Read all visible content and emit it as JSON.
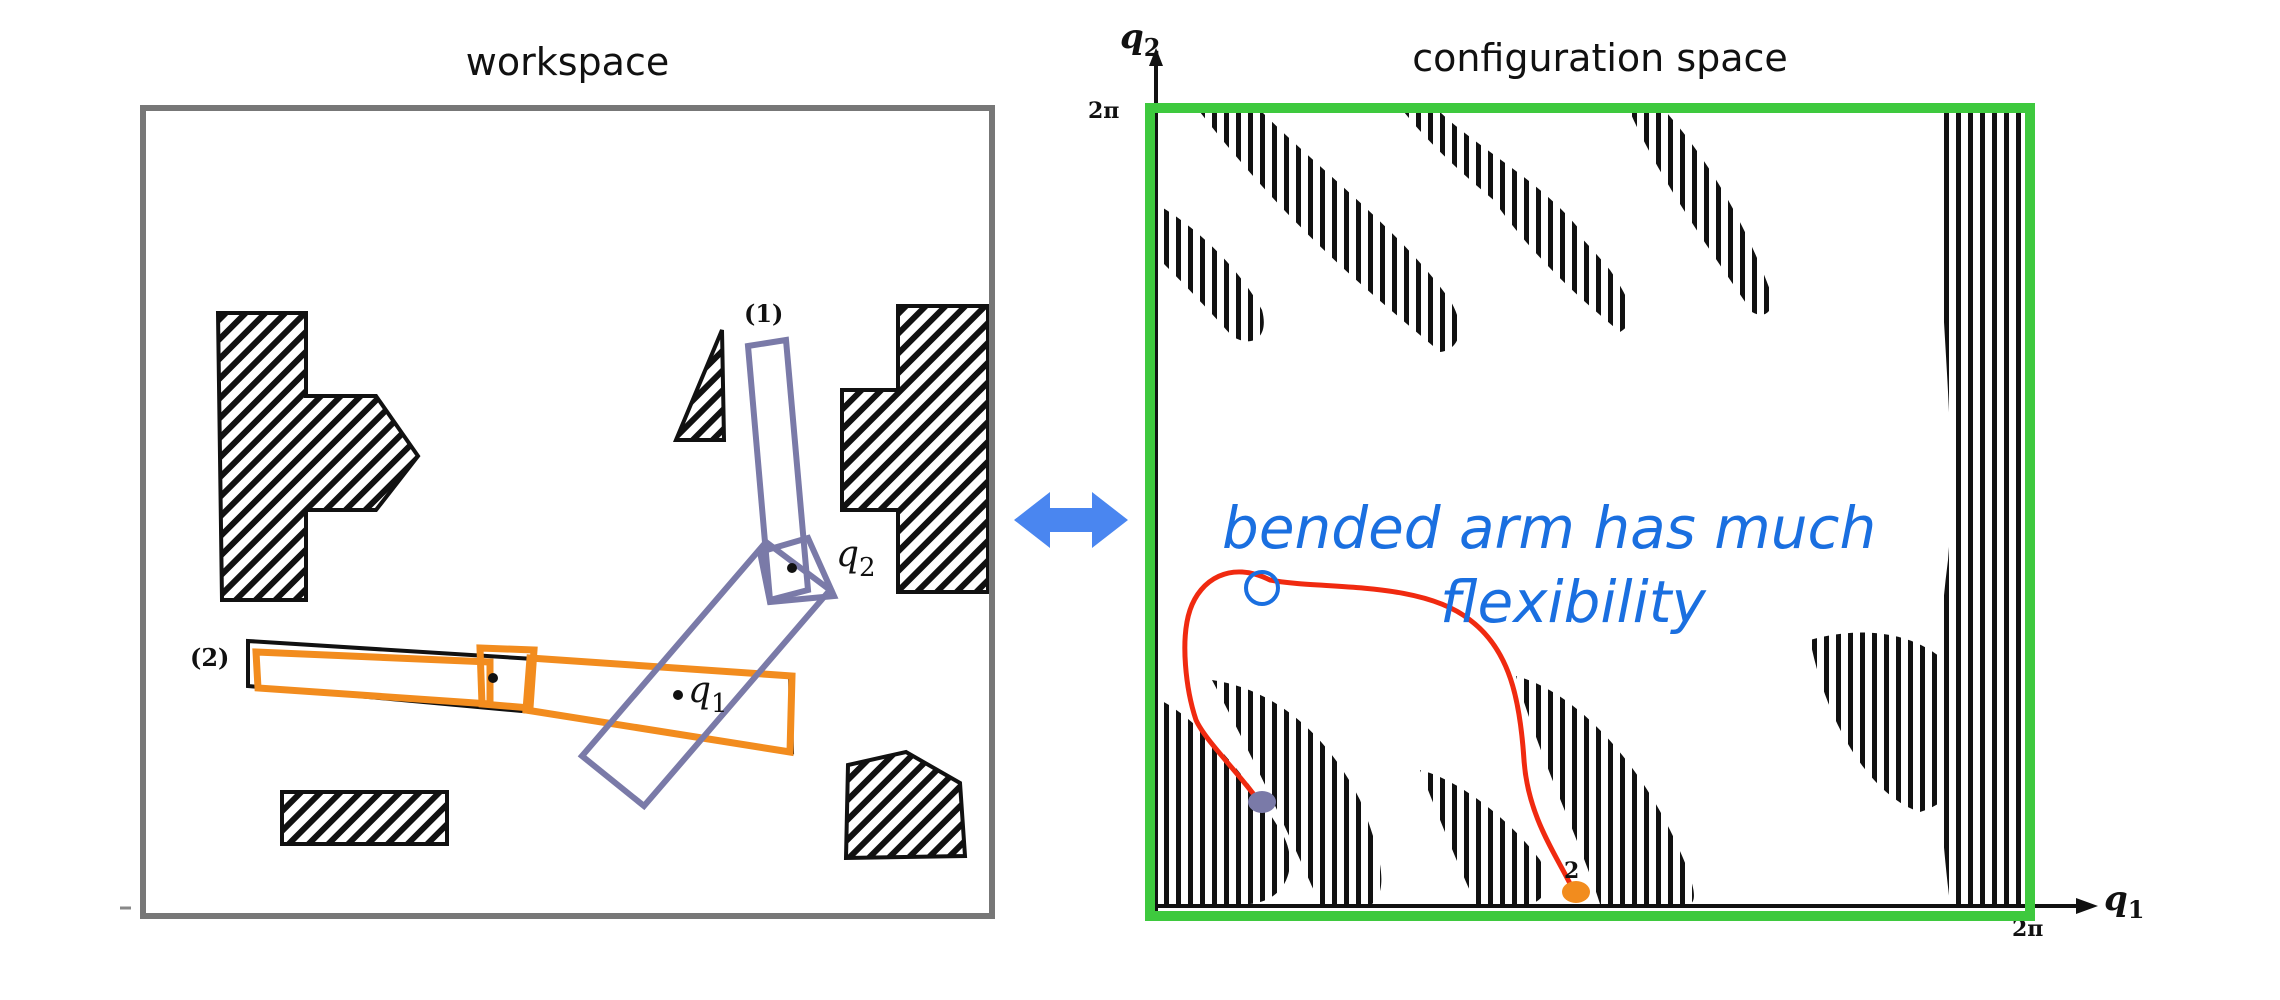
{
  "workspace": {
    "title": "workspace",
    "config_labels": {
      "one": "(1)",
      "two": "(2)"
    },
    "joint_labels": {
      "q1": "q",
      "q1_sub": "1",
      "q2": "q",
      "q2_sub": "2"
    }
  },
  "cspace": {
    "title": "configuration space",
    "axis_labels": {
      "q2": "q",
      "q2_sub": "2",
      "q1": "q",
      "q1_sub": "1",
      "two_pi_top": "2π",
      "two_pi_right": "2π"
    },
    "point_label": "2",
    "annotation": [
      "bended arm has much",
      "flexibility"
    ]
  },
  "colors": {
    "workspace_frame": "#777777",
    "cspace_frame": "#3ec93e",
    "config_1": "#7a7aa8",
    "config_2": "#f28c1e",
    "path": "#f02a10",
    "annotation": "#1a6fe0",
    "arrow": "#4a86f0"
  }
}
